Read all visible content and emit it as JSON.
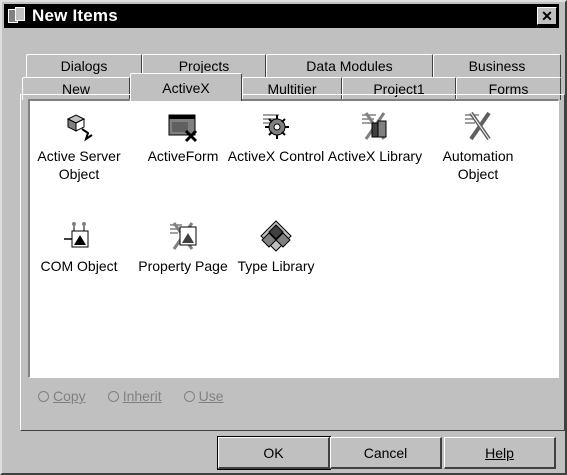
{
  "window": {
    "title": "New Items",
    "close_glyph": "✕"
  },
  "tabs_back": [
    "Dialogs",
    "Projects",
    "Data Modules",
    "Business"
  ],
  "tabs_front": [
    "New",
    "ActiveX",
    "Multitier",
    "Project1",
    "Forms"
  ],
  "active_tab": "ActiveX",
  "items": [
    {
      "label": "Active Server Object",
      "icon": "active-server-object-icon",
      "selected": false
    },
    {
      "label": "ActiveForm",
      "icon": "activeform-icon",
      "selected": true
    },
    {
      "label": "ActiveX Control",
      "icon": "activex-control-icon",
      "selected": false
    },
    {
      "label": "ActiveX Library",
      "icon": "activex-library-icon",
      "selected": false
    },
    {
      "label": "Automation Object",
      "icon": "automation-object-icon",
      "selected": false
    },
    {
      "label": "COM Object",
      "icon": "com-object-icon",
      "selected": false
    },
    {
      "label": "Property Page",
      "icon": "property-page-icon",
      "selected": false
    },
    {
      "label": "Type Library",
      "icon": "type-library-icon",
      "selected": false
    }
  ],
  "options": [
    {
      "label": "Copy",
      "hotkey": "C"
    },
    {
      "label": "Inherit",
      "hotkey": "I"
    },
    {
      "label": "Use",
      "hotkey": "U"
    }
  ],
  "buttons": {
    "ok": "OK",
    "cancel": "Cancel",
    "help": "Help"
  },
  "colors": {
    "face": "#c0c0c0",
    "selection": "#000080",
    "disabled_text": "#808080"
  }
}
